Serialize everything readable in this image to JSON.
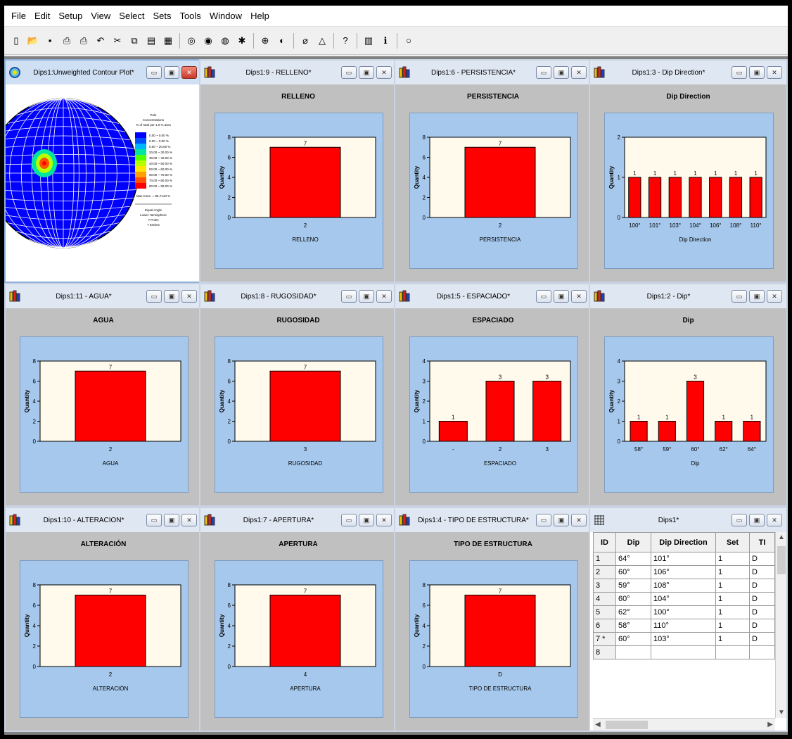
{
  "menu": [
    "File",
    "Edit",
    "Setup",
    "View",
    "Select",
    "Sets",
    "Tools",
    "Window",
    "Help"
  ],
  "toolbar_icons": [
    "new-file-icon",
    "open-icon",
    "save-icon",
    "print-preview-icon",
    "print-icon",
    "undo-icon",
    "cut-icon",
    "copy-icon",
    "paste-icon",
    "table-icon",
    "sep",
    "pole-plot-icon",
    "scatter-plot-icon",
    "contour-plot-icon",
    "rosette-icon",
    "sep",
    "stereonet-icon",
    "set-window-icon",
    "sep",
    "plane-icon",
    "cone-icon",
    "sep",
    "query-icon",
    "sep",
    "chart-icon",
    "info-icon",
    "sep",
    "circle-icon"
  ],
  "colors": {
    "bar": "#ff0000",
    "panel": "#a6c8ec",
    "plot_bg": "#fffaeb"
  },
  "contour": {
    "title": "Dips1:Unweighted Contour Plot*",
    "legend": [
      "Pole",
      "Concentrations",
      "% of total per 1.0 % area",
      "0.00 ~ 0.00 %",
      "0.00 ~ 0.00 %",
      "0.00 ~ 20.00 %",
      "20.00 ~ 30.00 %",
      "30.00 ~ 40.00 %",
      "40.00 ~ 50.00 %",
      "50.00 ~ 60.00 %",
      "60.00 ~ 70.00 %",
      "70.00 ~ 80.00 %",
      "80.00 ~ 90.00 %",
      "Max.Conc. = 85.7143 %",
      "Equal Angle",
      "Lower Hemisphere",
      "7 Poles",
      "7 Entries"
    ],
    "legend_colors": [
      "#0000ff",
      "#0050ff",
      "#00b4ff",
      "#00e6a0",
      "#50ff00",
      "#b4ff00",
      "#ffe600",
      "#ffa000",
      "#ff5000",
      "#ff0000"
    ]
  },
  "charts": [
    {
      "window_title": "Dips1:9 - RELLENO*",
      "chart_data": {
        "type": "bar",
        "title": "RELLENO",
        "xlabel": "RELLENO",
        "ylabel": "Quantity",
        "categories": [
          "2"
        ],
        "values": [
          7
        ],
        "ylim": [
          0,
          8
        ],
        "yticks": [
          0,
          2,
          4,
          6,
          8
        ]
      }
    },
    {
      "window_title": "Dips1:6 - PERSISTENCIA*",
      "chart_data": {
        "type": "bar",
        "title": "PERSISTENCIA",
        "xlabel": "PERSISTENCIA",
        "ylabel": "Quantity",
        "categories": [
          "2"
        ],
        "values": [
          7
        ],
        "ylim": [
          0,
          8
        ],
        "yticks": [
          0,
          2,
          4,
          6,
          8
        ]
      }
    },
    {
      "window_title": "Dips1:3 - Dip Direction*",
      "chart_data": {
        "type": "bar",
        "title": "Dip Direction",
        "xlabel": "Dip Direction",
        "ylabel": "Quantity",
        "categories": [
          "100°",
          "101°",
          "103°",
          "104°",
          "106°",
          "108°",
          "110°"
        ],
        "values": [
          1,
          1,
          1,
          1,
          1,
          1,
          1
        ],
        "ylim": [
          0,
          2
        ],
        "yticks": [
          0,
          1,
          2
        ]
      }
    },
    {
      "window_title": "Dips1:11 - AGUA*",
      "chart_data": {
        "type": "bar",
        "title": "AGUA",
        "xlabel": "AGUA",
        "ylabel": "Quantity",
        "categories": [
          "2"
        ],
        "values": [
          7
        ],
        "ylim": [
          0,
          8
        ],
        "yticks": [
          0,
          2,
          4,
          6,
          8
        ]
      }
    },
    {
      "window_title": "Dips1:8 - RUGOSIDAD*",
      "chart_data": {
        "type": "bar",
        "title": "RUGOSIDAD",
        "xlabel": "RUGOSIDAD",
        "ylabel": "Quantity",
        "categories": [
          "3"
        ],
        "values": [
          7
        ],
        "ylim": [
          0,
          8
        ],
        "yticks": [
          0,
          2,
          4,
          6,
          8
        ]
      }
    },
    {
      "window_title": "Dips1:5 - ESPACIADO*",
      "chart_data": {
        "type": "bar",
        "title": "ESPACIADO",
        "xlabel": "ESPACIADO",
        "ylabel": "Quantity",
        "categories": [
          "-",
          "2",
          "3"
        ],
        "values": [
          1,
          3,
          3
        ],
        "ylim": [
          0,
          4
        ],
        "yticks": [
          0,
          1,
          2,
          3,
          4
        ]
      }
    },
    {
      "window_title": "Dips1:2 - Dip*",
      "chart_data": {
        "type": "bar",
        "title": "Dip",
        "xlabel": "Dip",
        "ylabel": "Quantity",
        "categories": [
          "58°",
          "59°",
          "60°",
          "62°",
          "64°"
        ],
        "values": [
          1,
          1,
          3,
          1,
          1
        ],
        "ylim": [
          0,
          4
        ],
        "yticks": [
          0,
          1,
          2,
          3,
          4
        ]
      }
    },
    {
      "window_title": "Dips1:10 - ALTERACIÓN*",
      "chart_data": {
        "type": "bar",
        "title": "ALTERACIÓN",
        "xlabel": "ALTERACIÓN",
        "ylabel": "Quantity",
        "categories": [
          "2"
        ],
        "values": [
          7
        ],
        "ylim": [
          0,
          8
        ],
        "yticks": [
          0,
          2,
          4,
          6,
          8
        ]
      }
    },
    {
      "window_title": "Dips1:7 - APERTURA*",
      "chart_data": {
        "type": "bar",
        "title": "APERTURA",
        "xlabel": "APERTURA",
        "ylabel": "Quantity",
        "categories": [
          "4"
        ],
        "values": [
          7
        ],
        "ylim": [
          0,
          8
        ],
        "yticks": [
          0,
          2,
          4,
          6,
          8
        ]
      }
    },
    {
      "window_title": "Dips1:4 - TIPO DE ESTRUCTURA*",
      "chart_data": {
        "type": "bar",
        "title": "TIPO DE ESTRUCTURA",
        "xlabel": "TIPO DE ESTRUCTURA",
        "ylabel": "Quantity",
        "categories": [
          "D"
        ],
        "values": [
          7
        ],
        "ylim": [
          0,
          8
        ],
        "yticks": [
          0,
          2,
          4,
          6,
          8
        ]
      }
    }
  ],
  "grid": {
    "window_title": "Dips1*",
    "columns": [
      "ID",
      "Dip",
      "Dip Direction",
      "Set",
      "TI"
    ],
    "rows": [
      [
        "1",
        "64°",
        "101°",
        "1",
        "D"
      ],
      [
        "2",
        "60°",
        "106°",
        "1",
        "D"
      ],
      [
        "3",
        "59°",
        "108°",
        "1",
        "D"
      ],
      [
        "4",
        "60°",
        "104°",
        "1",
        "D"
      ],
      [
        "5",
        "62°",
        "100°",
        "1",
        "D"
      ],
      [
        "6",
        "58°",
        "110°",
        "1",
        "D"
      ],
      [
        "7 *",
        "60°",
        "103°",
        "1",
        "D"
      ],
      [
        "8",
        "",
        "",
        "",
        ""
      ]
    ]
  }
}
